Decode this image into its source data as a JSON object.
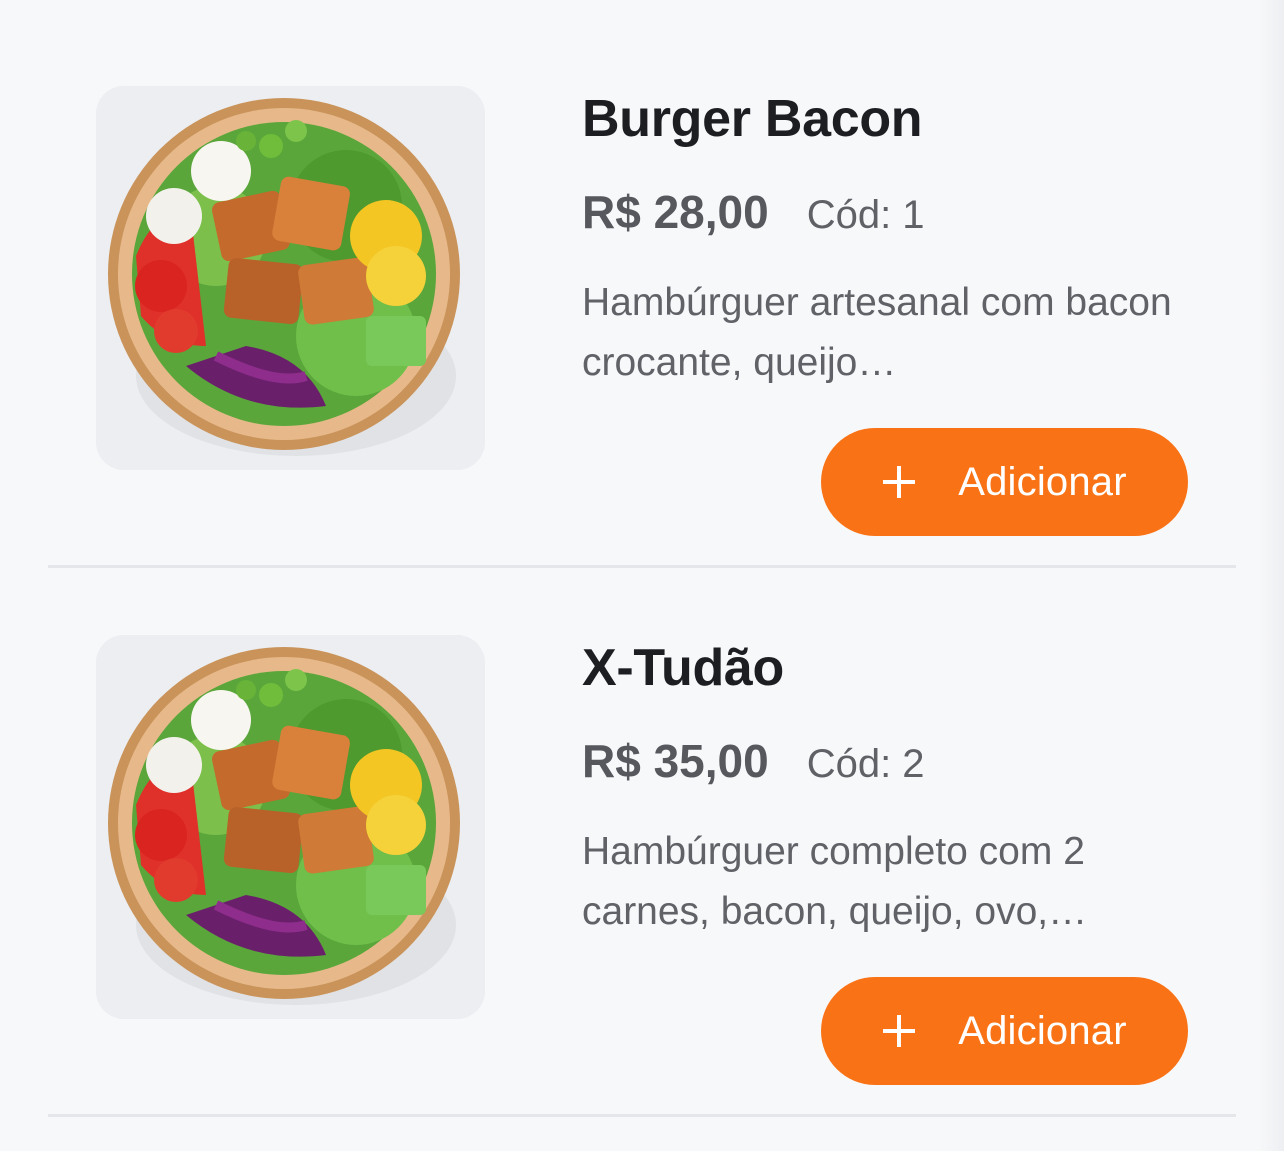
{
  "accent_color": "#f97316",
  "products": [
    {
      "name": "Burger Bacon",
      "price": "R$ 28,00",
      "code": "Cód: 1",
      "description": "Hambúrguer artesanal com bacon crocante, queijo…",
      "add_icon": "plus-icon",
      "add_label": "Adicionar"
    },
    {
      "name": "X-Tudão",
      "price": "R$ 35,00",
      "code": "Cód: 2",
      "description": "Hambúrguer completo com 2 carnes, bacon, queijo, ovo,…",
      "add_icon": "plus-icon",
      "add_label": "Adicionar"
    }
  ]
}
